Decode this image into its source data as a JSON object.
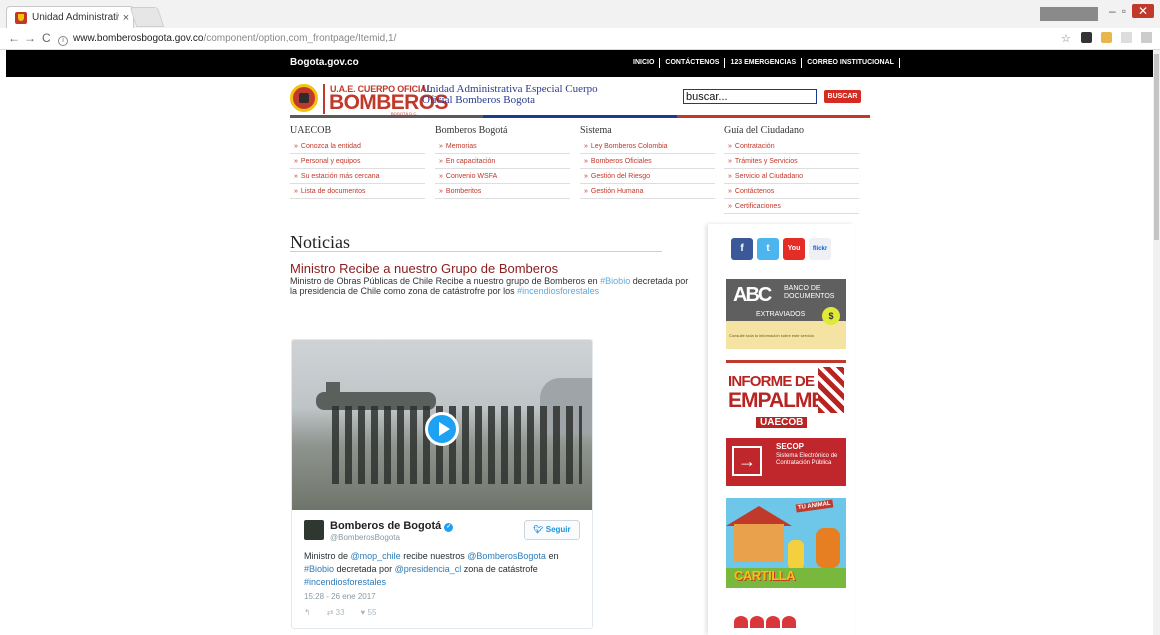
{
  "browser": {
    "tab_title": "Unidad Administrativa E",
    "tab_close": "×",
    "url_host": "www.bomberosbogota.gov.co",
    "url_path": "/component/option,com_frontpage/Itemid,1/",
    "back": "←",
    "forward": "→",
    "reload": "C",
    "info": "i",
    "star": "☆",
    "minimize": "–",
    "restore": "▫",
    "close": "✕"
  },
  "topbar": {
    "site": "Bogota.gov.co",
    "nav": [
      "INICIO",
      "CONTÁCTENOS",
      "123 EMERGENCIAS",
      "CORREO INSTITUCIONAL"
    ]
  },
  "header": {
    "logo_line1": "U.A.E. CUERPO OFICIAL",
    "logo_line2": "BOMBEROS",
    "logo_line3": "BOGOTÁ D.C.",
    "org_name": "Unidad Administrativa Especial Cuerpo Oficial Bomberos Bogota",
    "search_value": "buscar...",
    "search_button": "BUSCAR"
  },
  "menu": [
    {
      "title": "UAECOB",
      "items": [
        "Conozca la entidad",
        "Personal y equipos",
        "Su estación más cercana",
        "Lista de documentos"
      ]
    },
    {
      "title": "Bomberos Bogotá",
      "items": [
        "Memorias",
        "En capacitación",
        "Convenio WSFA",
        "Bomberitos"
      ]
    },
    {
      "title": "Sistema",
      "items": [
        "Ley Bomberos Colombia",
        "Bomberos Oficiales",
        "Gestión del Riesgo",
        "Gestión Humana"
      ]
    },
    {
      "title": "Guía del Ciudadano",
      "items": [
        "Contratación",
        "Trámites y Servicios",
        "Servicio al Ciudadano",
        "Contáctenos",
        "Certificaciones"
      ]
    }
  ],
  "news": {
    "section": "Noticias",
    "headline": "Ministro Recibe a nuestro Grupo de Bomberos",
    "body_1": "Ministro de Obras Públicas de Chile Recibe a nuestro grupo de Bomberos en ",
    "body_tag1": "#Biobio",
    "body_2": " decretada por la presidencia de Chile como zona de catástrofre por los ",
    "body_tag2": "#incendiosforestales"
  },
  "tweet": {
    "name": "Bomberos de Bogotá",
    "verified": "✓",
    "handle": "@BomberosBogota",
    "follow": "Seguir",
    "text_1": "Ministro de ",
    "m1": "@mop_chile",
    "text_2": " recibe nuestros ",
    "m2": "@BomberosBogota",
    "text_3": " en ",
    "m3": "#Biobio",
    "text_4": " decretada por ",
    "m4": "@presidencia_cl",
    "text_5": " zona de catástrofe ",
    "m5": "#incendiosforestales",
    "date": "15:28 - 26 ene 2017",
    "reply": "↰",
    "retweets": "⇄ 33",
    "likes": "♥ 55"
  },
  "sidebar": {
    "social": [
      "f",
      "t",
      "You Tube",
      "flickr"
    ],
    "abc": {
      "letters": "ABC",
      "title": "BANCO DE DOCUMENTOS",
      "sub": "EXTRAVIADOS",
      "coin": "$",
      "foot": "Consulte toda la información sobre este servicio"
    },
    "empalme": {
      "l1": "INFORME DE",
      "l2": "EMPALME",
      "l3": "UAECOB"
    },
    "secop": {
      "title": "SECOP",
      "sub": "Sistema Electrónico de Contratación Pública"
    },
    "cartilla": {
      "sign": "TU ANIMAL",
      "label": "CARTILLA"
    }
  },
  "colors": {
    "brand_red": "#c0392b",
    "brand_blue": "#1a3c8e",
    "twitter_blue": "#1da1f2"
  }
}
